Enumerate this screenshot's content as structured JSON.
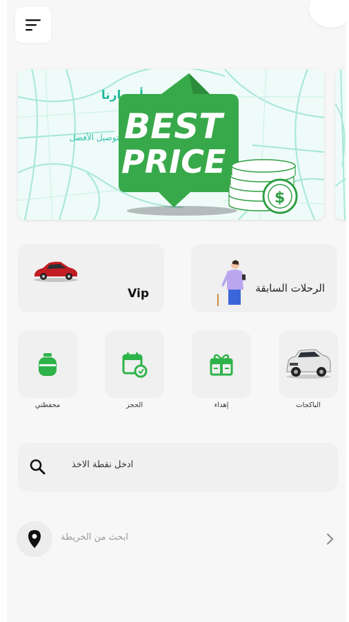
{
  "banner": {
    "title": "أسعارنا",
    "subtitle": "أسعار التوصيل الأفضل",
    "badge_line1": "BEST",
    "badge_line2": "PRICE",
    "coin_symbol": "$"
  },
  "cards": {
    "vip_label": "Vip",
    "trips_label": "الرحلات السابقة"
  },
  "services": [
    {
      "label": "الباكجات",
      "icon": "suv-car-icon"
    },
    {
      "label": "إهداء",
      "icon": "gift-icon"
    },
    {
      "label": "الحجز",
      "icon": "calendar-icon"
    },
    {
      "label": "محفظتي",
      "icon": "gas-cylinder-icon"
    }
  ],
  "search": {
    "placeholder": "ادخل نقطة الاخذ"
  },
  "map": {
    "text": "ابحث من الخريطة"
  },
  "colors": {
    "accent": "#2eb34a",
    "teal": "#1fb89c",
    "card_bg": "#f0f0f0",
    "screen_bg": "#f7f7f8"
  }
}
